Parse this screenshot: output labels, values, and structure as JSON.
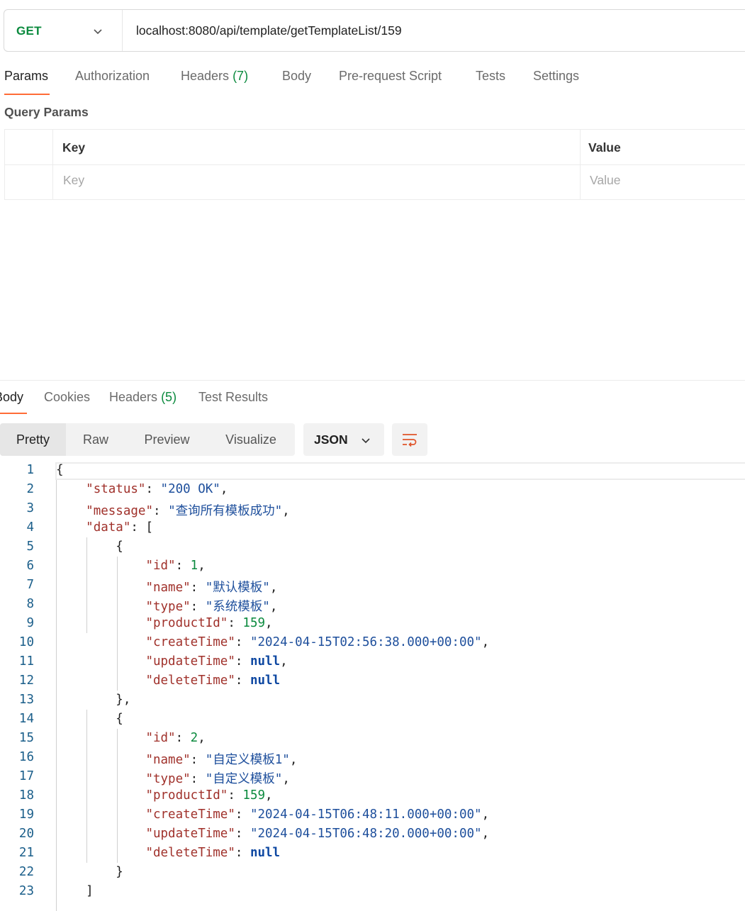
{
  "request": {
    "method": "GET",
    "url": "localhost:8080/api/template/getTemplateList/159"
  },
  "request_tabs": [
    {
      "label": "Params",
      "count": ""
    },
    {
      "label": "Authorization",
      "count": ""
    },
    {
      "label": "Headers",
      "count": "(7)"
    },
    {
      "label": "Body",
      "count": ""
    },
    {
      "label": "Pre-request Script",
      "count": ""
    },
    {
      "label": "Tests",
      "count": ""
    },
    {
      "label": "Settings",
      "count": ""
    }
  ],
  "query_params": {
    "title": "Query Params",
    "columns": [
      "Key",
      "Value"
    ],
    "placeholders": {
      "key": "Key",
      "value": "Value"
    }
  },
  "response_tabs": [
    {
      "label": "Body",
      "count": ""
    },
    {
      "label": "Cookies",
      "count": ""
    },
    {
      "label": "Headers",
      "count": "(5)"
    },
    {
      "label": "Test Results",
      "count": ""
    }
  ],
  "view_modes": [
    "Pretty",
    "Raw",
    "Preview",
    "Visualize"
  ],
  "format": "JSON",
  "icons": {
    "method_dropdown": "chevron-down-icon",
    "format_dropdown": "chevron-down-icon",
    "wrap": "wrap-lines-icon"
  },
  "colors": {
    "accent": "#ff6c37",
    "method": "#0b8a3e",
    "json_key": "#a0312b",
    "json_string": "#1e4f9c",
    "json_number": "#0b8a3e",
    "json_null": "#0d47a1"
  },
  "response_lines": [
    [
      {
        "t": "p",
        "v": "{"
      }
    ],
    [
      {
        "t": "p",
        "v": "    "
      },
      {
        "t": "k",
        "v": "\"status\""
      },
      {
        "t": "p",
        "v": ": "
      },
      {
        "t": "s",
        "v": "\"200 OK\""
      },
      {
        "t": "p",
        "v": ","
      }
    ],
    [
      {
        "t": "p",
        "v": "    "
      },
      {
        "t": "k",
        "v": "\"message\""
      },
      {
        "t": "p",
        "v": ": "
      },
      {
        "t": "s",
        "v": "\"查询所有模板成功\""
      },
      {
        "t": "p",
        "v": ","
      }
    ],
    [
      {
        "t": "p",
        "v": "    "
      },
      {
        "t": "k",
        "v": "\"data\""
      },
      {
        "t": "p",
        "v": ": ["
      }
    ],
    [
      {
        "t": "p",
        "v": "        {"
      }
    ],
    [
      {
        "t": "p",
        "v": "            "
      },
      {
        "t": "k",
        "v": "\"id\""
      },
      {
        "t": "p",
        "v": ": "
      },
      {
        "t": "n",
        "v": "1"
      },
      {
        "t": "p",
        "v": ","
      }
    ],
    [
      {
        "t": "p",
        "v": "            "
      },
      {
        "t": "k",
        "v": "\"name\""
      },
      {
        "t": "p",
        "v": ": "
      },
      {
        "t": "s",
        "v": "\"默认模板\""
      },
      {
        "t": "p",
        "v": ","
      }
    ],
    [
      {
        "t": "p",
        "v": "            "
      },
      {
        "t": "k",
        "v": "\"type\""
      },
      {
        "t": "p",
        "v": ": "
      },
      {
        "t": "s",
        "v": "\"系统模板\""
      },
      {
        "t": "p",
        "v": ","
      }
    ],
    [
      {
        "t": "p",
        "v": "            "
      },
      {
        "t": "k",
        "v": "\"productId\""
      },
      {
        "t": "p",
        "v": ": "
      },
      {
        "t": "n",
        "v": "159"
      },
      {
        "t": "p",
        "v": ","
      }
    ],
    [
      {
        "t": "p",
        "v": "            "
      },
      {
        "t": "k",
        "v": "\"createTime\""
      },
      {
        "t": "p",
        "v": ": "
      },
      {
        "t": "s",
        "v": "\"2024-04-15T02:56:38.000+00:00\""
      },
      {
        "t": "p",
        "v": ","
      }
    ],
    [
      {
        "t": "p",
        "v": "            "
      },
      {
        "t": "k",
        "v": "\"updateTime\""
      },
      {
        "t": "p",
        "v": ": "
      },
      {
        "t": "kw",
        "v": "null"
      },
      {
        "t": "p",
        "v": ","
      }
    ],
    [
      {
        "t": "p",
        "v": "            "
      },
      {
        "t": "k",
        "v": "\"deleteTime\""
      },
      {
        "t": "p",
        "v": ": "
      },
      {
        "t": "kw",
        "v": "null"
      }
    ],
    [
      {
        "t": "p",
        "v": "        },"
      }
    ],
    [
      {
        "t": "p",
        "v": "        {"
      }
    ],
    [
      {
        "t": "p",
        "v": "            "
      },
      {
        "t": "k",
        "v": "\"id\""
      },
      {
        "t": "p",
        "v": ": "
      },
      {
        "t": "n",
        "v": "2"
      },
      {
        "t": "p",
        "v": ","
      }
    ],
    [
      {
        "t": "p",
        "v": "            "
      },
      {
        "t": "k",
        "v": "\"name\""
      },
      {
        "t": "p",
        "v": ": "
      },
      {
        "t": "s",
        "v": "\"自定义模板1\""
      },
      {
        "t": "p",
        "v": ","
      }
    ],
    [
      {
        "t": "p",
        "v": "            "
      },
      {
        "t": "k",
        "v": "\"type\""
      },
      {
        "t": "p",
        "v": ": "
      },
      {
        "t": "s",
        "v": "\"自定义模板\""
      },
      {
        "t": "p",
        "v": ","
      }
    ],
    [
      {
        "t": "p",
        "v": "            "
      },
      {
        "t": "k",
        "v": "\"productId\""
      },
      {
        "t": "p",
        "v": ": "
      },
      {
        "t": "n",
        "v": "159"
      },
      {
        "t": "p",
        "v": ","
      }
    ],
    [
      {
        "t": "p",
        "v": "            "
      },
      {
        "t": "k",
        "v": "\"createTime\""
      },
      {
        "t": "p",
        "v": ": "
      },
      {
        "t": "s",
        "v": "\"2024-04-15T06:48:11.000+00:00\""
      },
      {
        "t": "p",
        "v": ","
      }
    ],
    [
      {
        "t": "p",
        "v": "            "
      },
      {
        "t": "k",
        "v": "\"updateTime\""
      },
      {
        "t": "p",
        "v": ": "
      },
      {
        "t": "s",
        "v": "\"2024-04-15T06:48:20.000+00:00\""
      },
      {
        "t": "p",
        "v": ","
      }
    ],
    [
      {
        "t": "p",
        "v": "            "
      },
      {
        "t": "k",
        "v": "\"deleteTime\""
      },
      {
        "t": "p",
        "v": ": "
      },
      {
        "t": "kw",
        "v": "null"
      }
    ],
    [
      {
        "t": "p",
        "v": "        }"
      }
    ],
    [
      {
        "t": "p",
        "v": "    ]"
      }
    ]
  ]
}
